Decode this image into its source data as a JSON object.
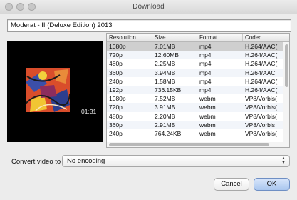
{
  "window": {
    "title": "Download"
  },
  "video_title": "Moderat - II (Deluxe Edition) 2013",
  "preview": {
    "time": "01:31"
  },
  "formats": {
    "columns": [
      "Resolution",
      "Size",
      "Format",
      "Codec"
    ],
    "rows": [
      [
        "1080p",
        "7.01MB",
        "mp4",
        "H.264/AAC("
      ],
      [
        "720p",
        "12.60MB",
        "mp4",
        "H.264/AAC("
      ],
      [
        "480p",
        "2.25MB",
        "mp4",
        "H.264/AAC("
      ],
      [
        "360p",
        "3.94MB",
        "mp4",
        "H.264/AAC"
      ],
      [
        "240p",
        "1.58MB",
        "mp4",
        "H.264/AAC("
      ],
      [
        "192p",
        "736.15KB",
        "mp4",
        "H.264/AAC("
      ],
      [
        "1080p",
        "7.52MB",
        "webm",
        "VP8/Vorbis("
      ],
      [
        "720p",
        "3.91MB",
        "webm",
        "VP8/Vorbis("
      ],
      [
        "480p",
        "2.20MB",
        "webm",
        "VP8/Vorbis("
      ],
      [
        "360p",
        "2.91MB",
        "webm",
        "VP8/Vorbis"
      ],
      [
        "240p",
        "764.24KB",
        "webm",
        "VP8/Vorbis("
      ]
    ],
    "selected_row": 0
  },
  "convert": {
    "label": "Convert video to",
    "value": "No encoding"
  },
  "buttons": {
    "cancel": "Cancel",
    "ok": "OK"
  }
}
